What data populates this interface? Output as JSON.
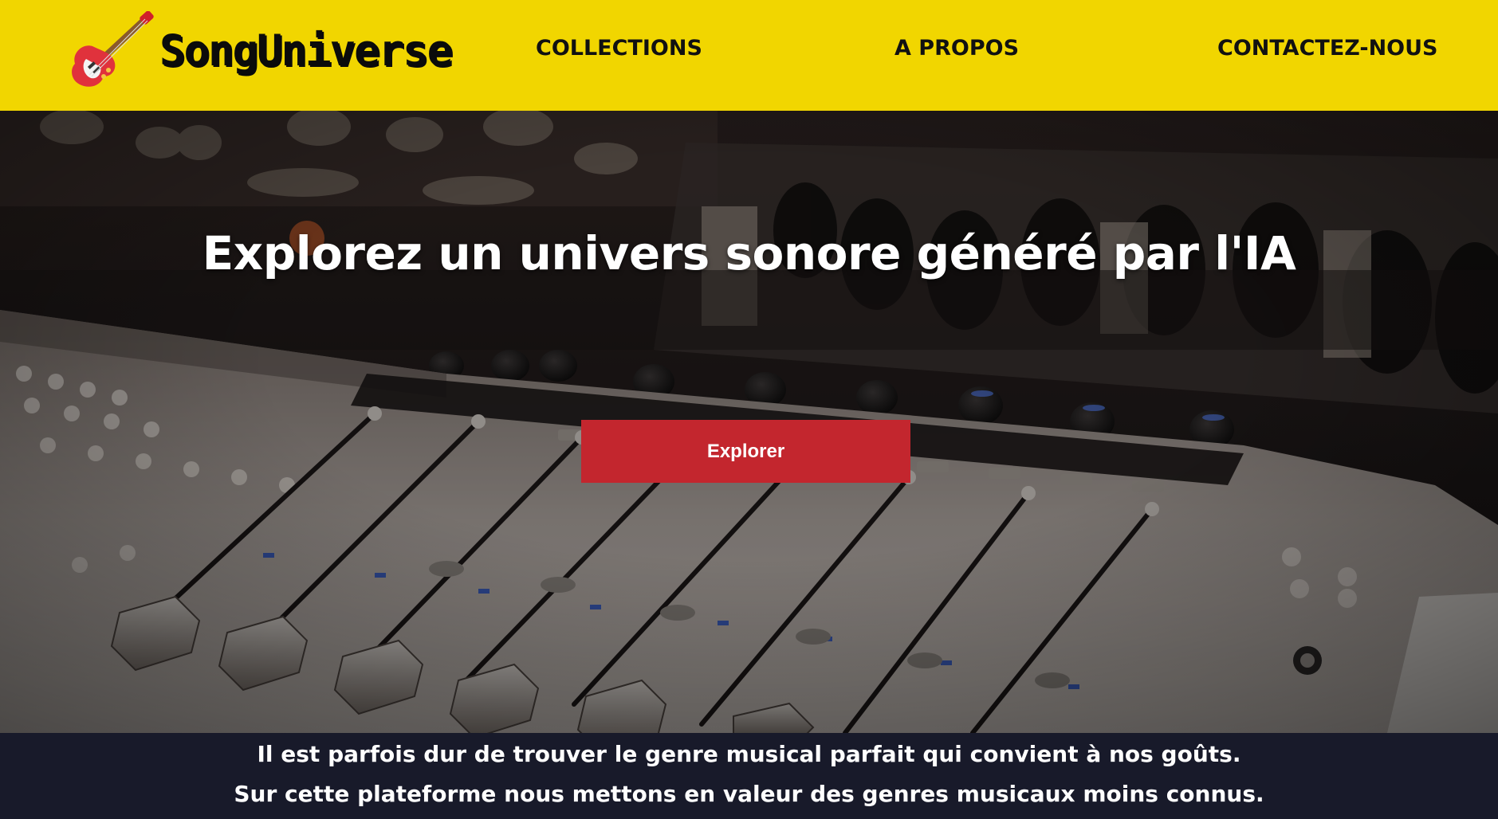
{
  "brand": {
    "name": "SongUniverse",
    "icon": "electric-guitar-icon"
  },
  "nav": [
    {
      "label": "COLLECTIONS"
    },
    {
      "label": "A PROPOS"
    },
    {
      "label": "CONTACTEZ-NOUS"
    }
  ],
  "hero": {
    "title": "Explorez un univers sonore généré par l'IA",
    "button_label": "Explorer",
    "background": "mixing-console-photo"
  },
  "intro": {
    "line1": "Il est parfois dur de trouver le genre musical parfait qui convient à nos goûts.",
    "line2": "Sur cette plateforme nous mettons en valeur des genres musicaux moins connus."
  },
  "colors": {
    "header_bg": "#f1d600",
    "button_bg": "#c3262e",
    "intro_bg": "#181a2a",
    "text_dark": "#111111",
    "text_light": "#ffffff"
  }
}
